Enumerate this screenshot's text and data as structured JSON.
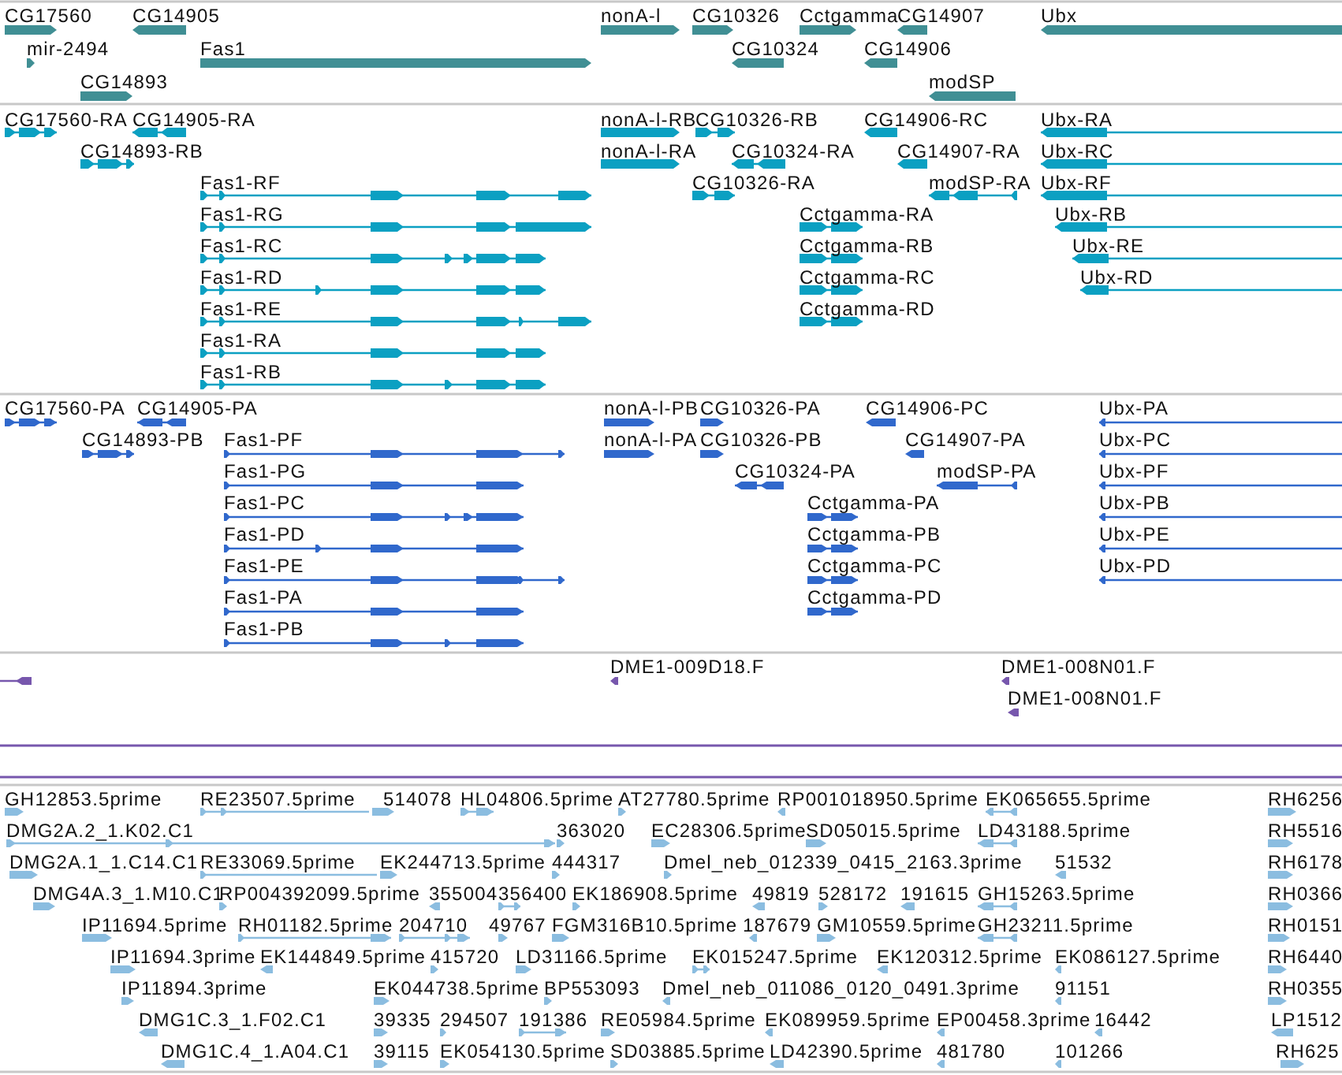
{
  "tracks": [
    {
      "color": "#408f94",
      "features": [
        {
          "label": "CG17560",
          "reverse": false
        },
        {
          "label": "CG14905",
          "reverse": true
        },
        {
          "label": "nonA-l",
          "reverse": false
        },
        {
          "label": "CG10326",
          "reverse": false
        },
        {
          "label": "Cctgamma",
          "reverse": false
        },
        {
          "label": "CG14907",
          "reverse": true
        },
        {
          "label": "Ubx",
          "reverse": true
        },
        {
          "label": "mir-2494",
          "reverse": false
        },
        {
          "label": "Fas1",
          "reverse": false
        },
        {
          "label": "CG10324",
          "reverse": true
        },
        {
          "label": "CG14906",
          "reverse": true
        },
        {
          "label": "CG14893",
          "reverse": false
        },
        {
          "label": "modSP",
          "reverse": true
        }
      ]
    },
    {
      "color": "#0ba0c2",
      "features": [
        {
          "label": "CG17560-RA",
          "reverse": false
        },
        {
          "label": "CG14905-RA",
          "reverse": true
        },
        {
          "label": "nonA-l-RB",
          "reverse": false
        },
        {
          "label": "CG10326-RB",
          "reverse": false
        },
        {
          "label": "CG14906-RC",
          "reverse": true
        },
        {
          "label": "Ubx-RA",
          "reverse": true
        },
        {
          "label": "CG14893-RB",
          "reverse": false
        },
        {
          "label": "nonA-l-RA",
          "reverse": false
        },
        {
          "label": "CG10324-RA",
          "reverse": true
        },
        {
          "label": "CG14907-RA",
          "reverse": true
        },
        {
          "label": "Ubx-RC",
          "reverse": true
        },
        {
          "label": "Fas1-RF",
          "reverse": false
        },
        {
          "label": "CG10326-RA",
          "reverse": false
        },
        {
          "label": "modSP-RA",
          "reverse": true
        },
        {
          "label": "Ubx-RF",
          "reverse": true
        },
        {
          "label": "Fas1-RG",
          "reverse": false
        },
        {
          "label": "Cctgamma-RA",
          "reverse": false
        },
        {
          "label": "Ubx-RB",
          "reverse": true
        },
        {
          "label": "Fas1-RC",
          "reverse": false
        },
        {
          "label": "Cctgamma-RB",
          "reverse": false
        },
        {
          "label": "Ubx-RE",
          "reverse": true
        },
        {
          "label": "Fas1-RD",
          "reverse": false
        },
        {
          "label": "Cctgamma-RC",
          "reverse": false
        },
        {
          "label": "Ubx-RD",
          "reverse": true
        },
        {
          "label": "Fas1-RE",
          "reverse": false
        },
        {
          "label": "Cctgamma-RD",
          "reverse": false
        },
        {
          "label": "Fas1-RA",
          "reverse": false
        },
        {
          "label": "Fas1-RB",
          "reverse": false
        }
      ]
    },
    {
      "color": "#3068cc",
      "features": [
        {
          "label": "CG17560-PA",
          "reverse": false
        },
        {
          "label": "CG14905-PA",
          "reverse": true
        },
        {
          "label": "nonA-l-PB",
          "reverse": false
        },
        {
          "label": "CG10326-PA",
          "reverse": false
        },
        {
          "label": "CG14906-PC",
          "reverse": true
        },
        {
          "label": "Ubx-PA",
          "reverse": true
        },
        {
          "label": "CG14893-PB",
          "reverse": false
        },
        {
          "label": "Fas1-PF",
          "reverse": false
        },
        {
          "label": "nonA-l-PA",
          "reverse": false
        },
        {
          "label": "CG10326-PB",
          "reverse": false
        },
        {
          "label": "CG14907-PA",
          "reverse": true
        },
        {
          "label": "Ubx-PC",
          "reverse": true
        },
        {
          "label": "Fas1-PG",
          "reverse": false
        },
        {
          "label": "CG10324-PA",
          "reverse": true
        },
        {
          "label": "modSP-PA",
          "reverse": true
        },
        {
          "label": "Ubx-PF",
          "reverse": true
        },
        {
          "label": "Fas1-PC",
          "reverse": false
        },
        {
          "label": "Cctgamma-PA",
          "reverse": false
        },
        {
          "label": "Ubx-PB",
          "reverse": true
        },
        {
          "label": "Fas1-PD",
          "reverse": false
        },
        {
          "label": "Cctgamma-PB",
          "reverse": false
        },
        {
          "label": "Ubx-PE",
          "reverse": true
        },
        {
          "label": "Fas1-PE",
          "reverse": false
        },
        {
          "label": "Cctgamma-PC",
          "reverse": false
        },
        {
          "label": "Ubx-PD",
          "reverse": true
        },
        {
          "label": "Fas1-PA",
          "reverse": false
        },
        {
          "label": "Cctgamma-PD",
          "reverse": false
        },
        {
          "label": "Fas1-PB",
          "reverse": false
        }
      ]
    },
    {
      "color": "#7757ad",
      "features": [
        {
          "reverse": true
        },
        {
          "label": "DME1-009D18.F",
          "reverse": true
        },
        {
          "label": "DME1-008N01.F",
          "reverse": true
        },
        {
          "label": "DME1-008N01.F",
          "reverse": true
        }
      ]
    },
    {
      "color": "#8bbde0",
      "features": [
        {
          "label": "GH12853.5prime",
          "reverse": false
        },
        {
          "label": "RE23507.5prime",
          "reverse": false
        },
        {
          "label": "514078",
          "reverse": false
        },
        {
          "label": "HL04806.5prime",
          "reverse": false
        },
        {
          "label": "AT27780.5prime",
          "reverse": false
        },
        {
          "label": "RP001018950.5prime",
          "reverse": true
        },
        {
          "label": "EK065655.5prime",
          "reverse": true
        },
        {
          "label": "RH6256",
          "reverse": false
        },
        {
          "label": "DMG2A.2_1.K02.C1",
          "reverse": false
        },
        {
          "label": "363020",
          "reverse": false
        },
        {
          "label": "EC28306.5prime",
          "reverse": false
        },
        {
          "label": "SD05015.5prime",
          "reverse": false
        },
        {
          "label": "LD43188.5prime",
          "reverse": true
        },
        {
          "label": "RH5516",
          "reverse": false
        },
        {
          "label": "DMG2A.1_1.C14.C1",
          "reverse": false
        },
        {
          "label": "RE33069.5prime",
          "reverse": false
        },
        {
          "label": "EK244713.5prime",
          "reverse": false
        },
        {
          "label": "444317",
          "reverse": false
        },
        {
          "label": "Dmel_neb_012339_0415_2163.3prime",
          "reverse": false
        },
        {
          "label": "51532",
          "reverse": true
        },
        {
          "label": "RH6178",
          "reverse": false
        },
        {
          "label": "DMG4A.3_1.M10.C1",
          "reverse": false
        },
        {
          "label": "RP004392099.5prime",
          "reverse": false
        },
        {
          "label": "355004",
          "reverse": true
        },
        {
          "label": "356400",
          "reverse": false
        },
        {
          "label": "EK186908.5prime",
          "reverse": false
        },
        {
          "label": "49819",
          "reverse": true
        },
        {
          "label": "528172",
          "reverse": false
        },
        {
          "label": "191615",
          "reverse": true
        },
        {
          "label": "GH15263.5prime",
          "reverse": true
        },
        {
          "label": "RH0366",
          "reverse": false
        },
        {
          "label": "IP11694.5prime",
          "reverse": false
        },
        {
          "label": "RH01182.5prime",
          "reverse": false
        },
        {
          "label": "204710",
          "reverse": false
        },
        {
          "label": "49767",
          "reverse": false
        },
        {
          "label": "FGM316B10.5prime",
          "reverse": false
        },
        {
          "label": "187679",
          "reverse": true
        },
        {
          "label": "GM10559.5prime",
          "reverse": false
        },
        {
          "label": "GH23211.5prime",
          "reverse": true
        },
        {
          "label": "RH0151",
          "reverse": false
        },
        {
          "label": "IP11694.3prime",
          "reverse": false
        },
        {
          "label": "EK144849.5prime",
          "reverse": true
        },
        {
          "label": "415720",
          "reverse": false
        },
        {
          "label": "LD31166.5prime",
          "reverse": false
        },
        {
          "label": "EK015247.5prime",
          "reverse": false
        },
        {
          "label": "EK120312.5prime",
          "reverse": true
        },
        {
          "label": "EK086127.5prime",
          "reverse": true
        },
        {
          "label": "RH6440",
          "reverse": false
        },
        {
          "label": "IP11894.3prime",
          "reverse": false
        },
        {
          "label": "EK044738.5prime",
          "reverse": false
        },
        {
          "label": "BP553093",
          "reverse": false
        },
        {
          "label": "Dmel_neb_011086_0120_0491.3prime",
          "reverse": true
        },
        {
          "label": "91151",
          "reverse": true
        },
        {
          "label": "RH0355",
          "reverse": false
        },
        {
          "label": "DMG1C.3_1.F02.C1",
          "reverse": true
        },
        {
          "label": "39335",
          "reverse": false
        },
        {
          "label": "294507",
          "reverse": false
        },
        {
          "label": "191386",
          "reverse": false
        },
        {
          "label": "RE05984.5prime",
          "reverse": false
        },
        {
          "label": "EK089959.5prime",
          "reverse": true
        },
        {
          "label": "EP00458.3prime",
          "reverse": true
        },
        {
          "label": "16442",
          "reverse": true
        },
        {
          "label": "LP1512",
          "reverse": true
        },
        {
          "label": "DMG1C.4_1.A04.C1",
          "reverse": true
        },
        {
          "label": "39115",
          "reverse": false
        },
        {
          "label": "EK054130.5prime",
          "reverse": false
        },
        {
          "label": "SD03885.5prime",
          "reverse": false
        },
        {
          "label": "LD42390.5prime",
          "reverse": true
        },
        {
          "label": "481780",
          "reverse": true
        },
        {
          "label": "101266",
          "reverse": true
        },
        {
          "label": "RH625",
          "reverse": false
        }
      ]
    }
  ]
}
